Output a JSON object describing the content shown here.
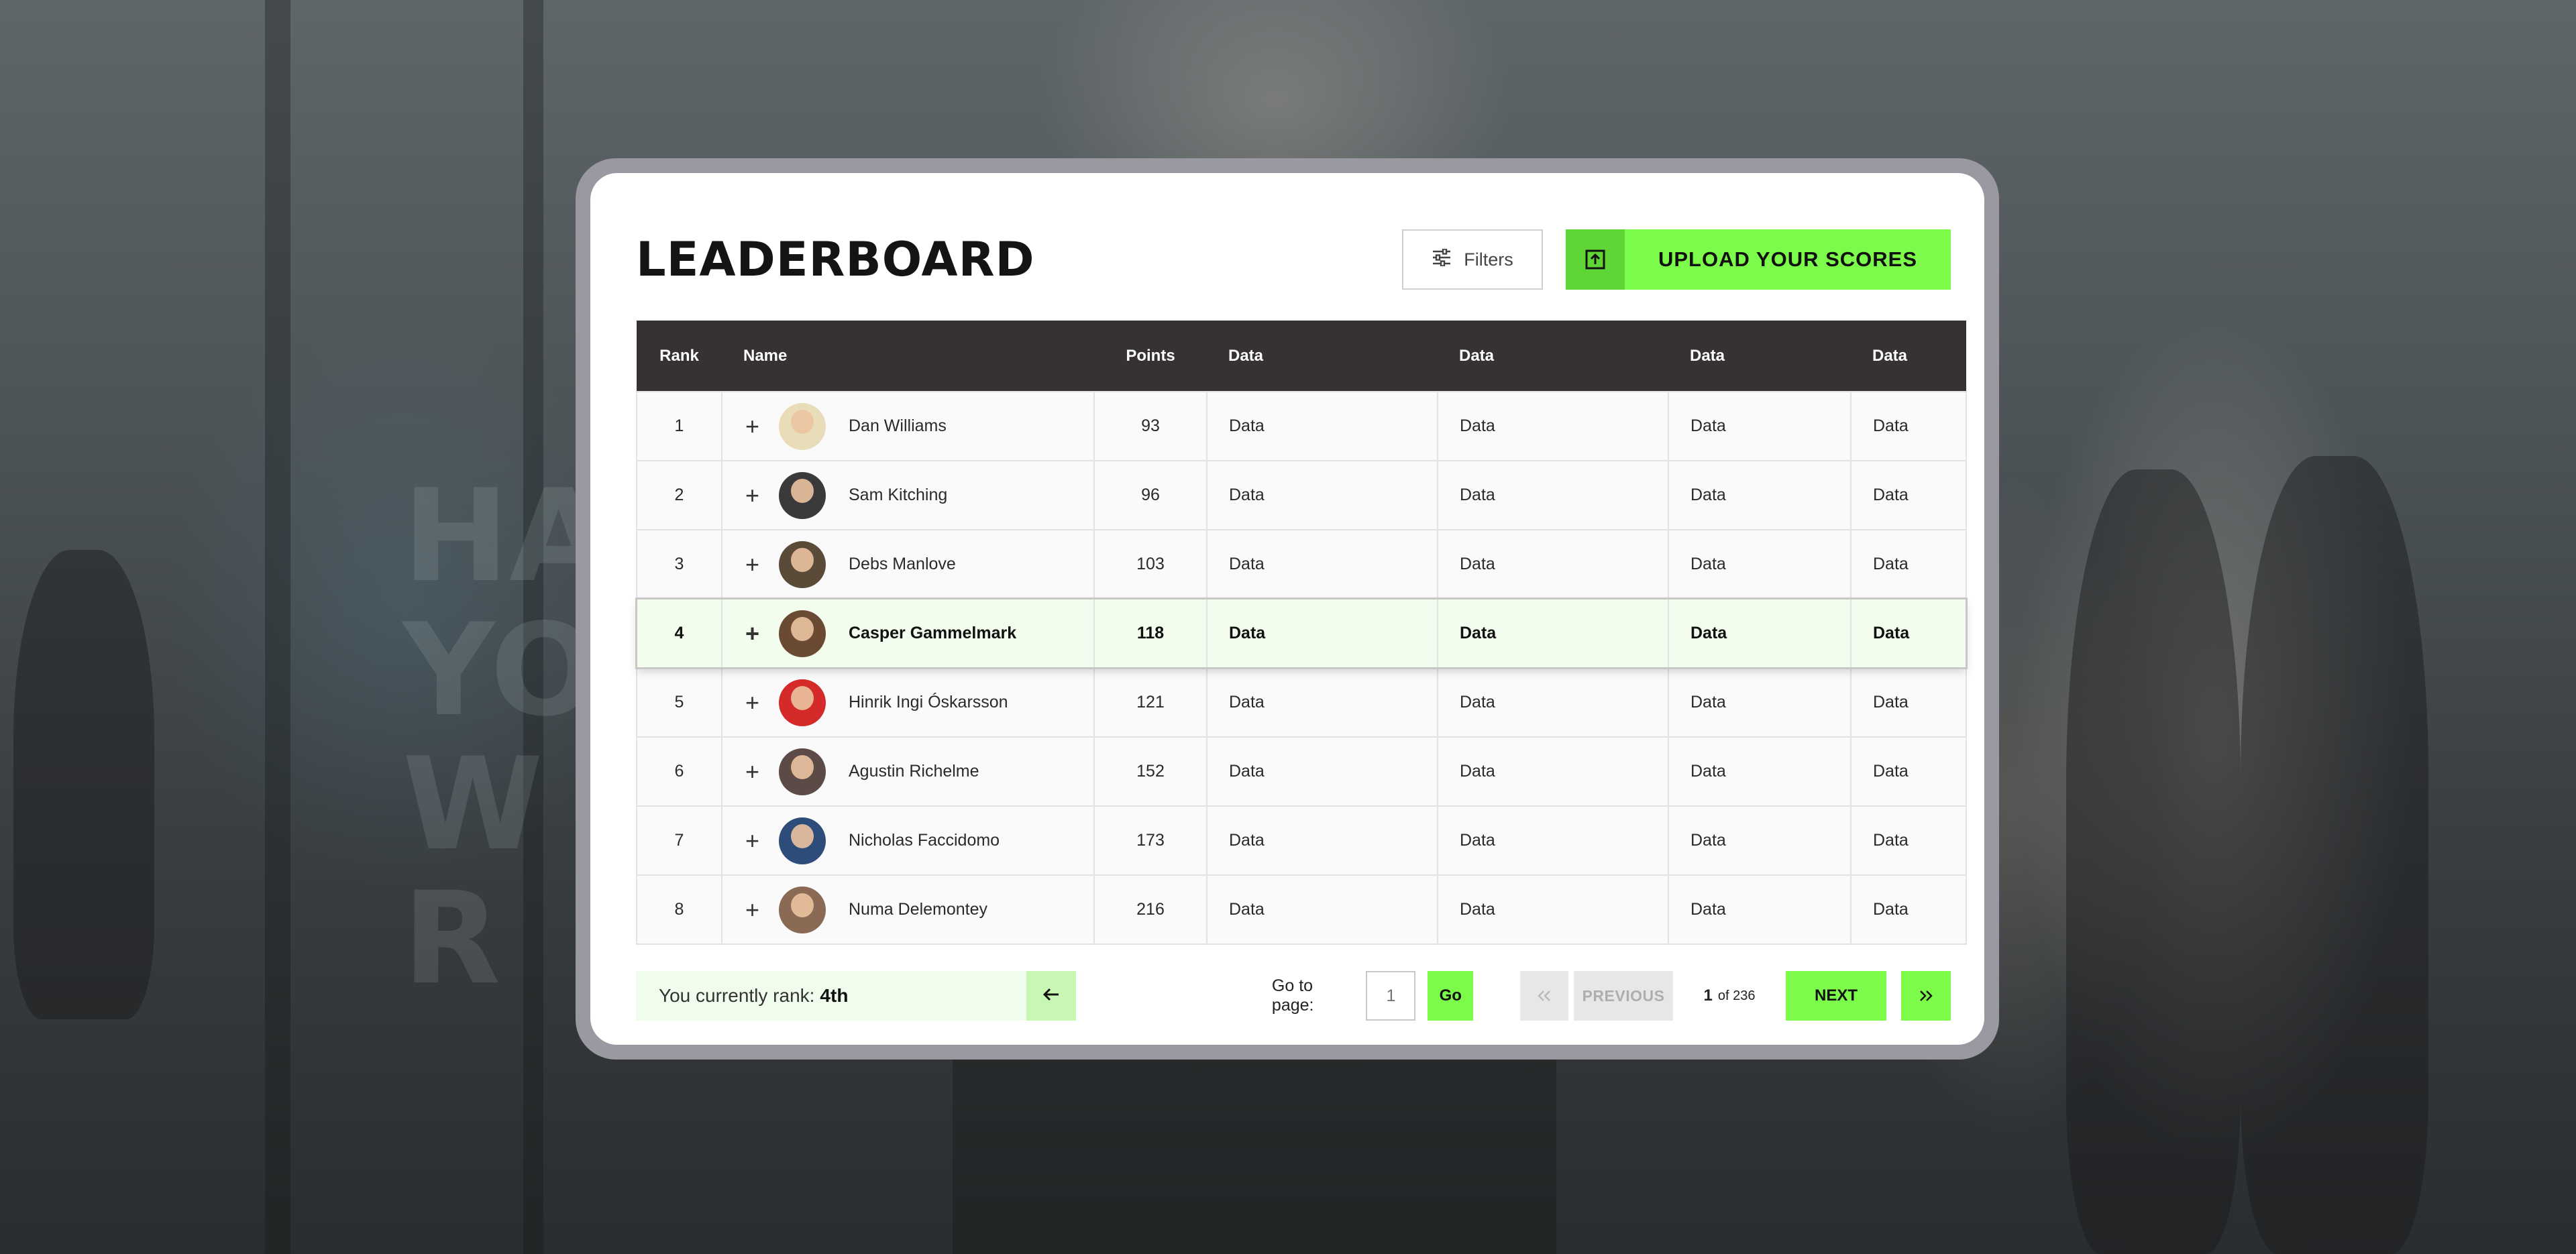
{
  "header": {
    "title": "LEADERBOARD",
    "filters_label": "Filters",
    "upload_label": "UPLOAD YOUR SCORES"
  },
  "table": {
    "columns": [
      "Rank",
      "Name",
      "Points",
      "Data",
      "Data",
      "Data",
      "Data"
    ],
    "rows": [
      {
        "rank": "1",
        "name": "Dan Williams",
        "points": "93",
        "data": [
          "Data",
          "Data",
          "Data",
          "Data"
        ],
        "avatar_color": "#e9dcb8"
      },
      {
        "rank": "2",
        "name": "Sam Kitching",
        "points": "96",
        "data": [
          "Data",
          "Data",
          "Data",
          "Data"
        ],
        "avatar_color": "#3a3a3a"
      },
      {
        "rank": "3",
        "name": "Debs Manlove",
        "points": "103",
        "data": [
          "Data",
          "Data",
          "Data",
          "Data"
        ],
        "avatar_color": "#5a4a38"
      },
      {
        "rank": "4",
        "name": "Casper Gammelmark",
        "points": "118",
        "data": [
          "Data",
          "Data",
          "Data",
          "Data"
        ],
        "avatar_color": "#6b4a34",
        "current_user": true
      },
      {
        "rank": "5",
        "name": "Hinrik Ingi Óskarsson",
        "points": "121",
        "data": [
          "Data",
          "Data",
          "Data",
          "Data"
        ],
        "avatar_color": "#d42a2a"
      },
      {
        "rank": "6",
        "name": "Agustin Richelme",
        "points": "152",
        "data": [
          "Data",
          "Data",
          "Data",
          "Data"
        ],
        "avatar_color": "#5b4a45"
      },
      {
        "rank": "7",
        "name": "Nicholas Faccidomo",
        "points": "173",
        "data": [
          "Data",
          "Data",
          "Data",
          "Data"
        ],
        "avatar_color": "#2e4c7a"
      },
      {
        "rank": "8",
        "name": "Numa Delemontey",
        "points": "216",
        "data": [
          "Data",
          "Data",
          "Data",
          "Data"
        ],
        "avatar_color": "#8a6a55"
      }
    ]
  },
  "footer": {
    "rank_prefix": "You currently rank:",
    "rank_value": "4th",
    "goto_label": "Go to page:",
    "goto_placeholder": "1",
    "go_label": "Go",
    "previous_label": "PREVIOUS",
    "current_page": "1",
    "of_label": "of 236",
    "next_label": "NEXT"
  },
  "colors": {
    "accent": "#7cfb4a",
    "table_header": "#363232",
    "highlight_row": "#f2fdee"
  },
  "icons": [
    "sliders-icon",
    "upload-icon",
    "plus-icon",
    "arrow-left-icon",
    "double-chevron-left-icon",
    "double-chevron-right-icon"
  ]
}
